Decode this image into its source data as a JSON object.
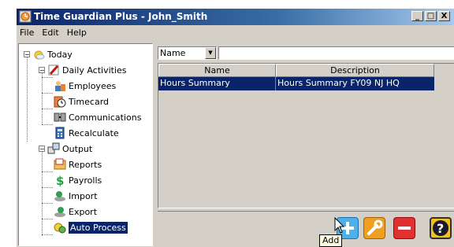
{
  "window": {
    "title": "Time Guardian Plus - John_Smith",
    "buttons": {
      "minimize": "_",
      "maximize": "□",
      "close": "X"
    }
  },
  "menu": {
    "items": [
      "File",
      "Edit",
      "Help"
    ]
  },
  "tree": {
    "root": {
      "label": "Today",
      "icon": "sun-icon"
    },
    "daily": {
      "label": "Daily Activities",
      "icon": "pencil-icon",
      "children": [
        {
          "label": "Employees",
          "icon": "employees-icon"
        },
        {
          "label": "Timecard",
          "icon": "timecard-icon"
        },
        {
          "label": "Communications",
          "icon": "communications-icon"
        },
        {
          "label": "Recalculate",
          "icon": "calculator-icon"
        }
      ]
    },
    "output": {
      "label": "Output",
      "icon": "output-icon",
      "children": [
        {
          "label": "Reports",
          "icon": "reports-icon"
        },
        {
          "label": "Payrolls",
          "icon": "payroll-icon"
        },
        {
          "label": "Import",
          "icon": "import-icon"
        },
        {
          "label": "Export",
          "icon": "export-icon"
        },
        {
          "label": "Auto Process",
          "icon": "auto-process-icon",
          "selected": true
        }
      ]
    }
  },
  "filter": {
    "field": "Name",
    "value": ""
  },
  "grid": {
    "columns": [
      "Name",
      "Description"
    ],
    "rows": [
      {
        "name": "Hours Summary",
        "description": "Hours Summary FY09 NJ HQ"
      }
    ]
  },
  "toolbar": {
    "buttons": [
      "add-button",
      "edit-button",
      "delete-button",
      "help-button"
    ],
    "tooltip": "Add"
  },
  "colors": {
    "selection": "#0a246a",
    "add": "#4fb0e8",
    "edit": "#f0a020",
    "delete": "#e03030",
    "help_bg": "#f0c020"
  }
}
